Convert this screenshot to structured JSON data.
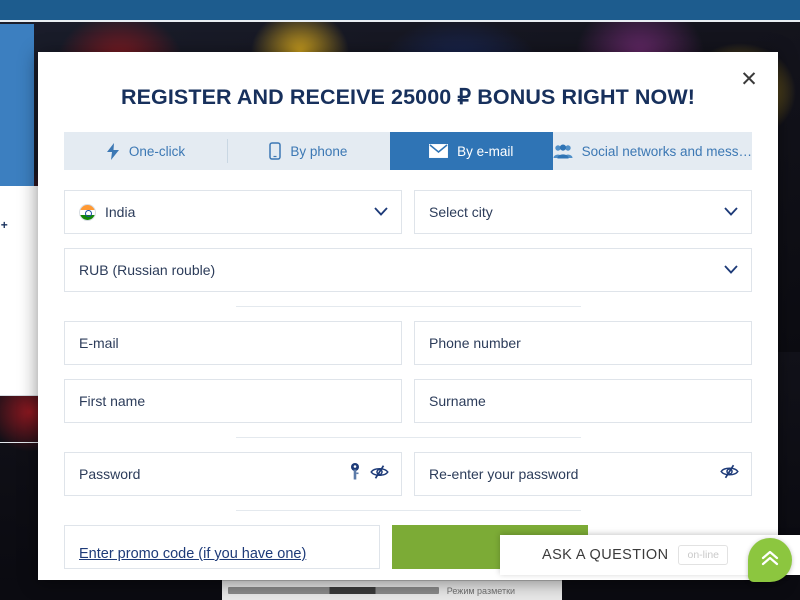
{
  "background": {
    "left_card_text": "| +",
    "status_bar_text": "Режим разметки",
    "top_bar_color": "#1d5c8e",
    "blue_panel_color": "#3c7fc0"
  },
  "modal": {
    "title": "REGISTER AND RECEIVE 25000 ₽ BONUS RIGHT NOW!",
    "close_label": "✕",
    "tabs": [
      {
        "label": "One-click",
        "icon": "bolt-icon",
        "active": false
      },
      {
        "label": "By phone",
        "icon": "phone-icon",
        "active": false
      },
      {
        "label": "By e-mail",
        "icon": "envelope-icon",
        "active": true
      },
      {
        "label": "Social networks and mess…",
        "icon": "people-icon",
        "active": false
      }
    ],
    "form": {
      "country": {
        "value": "India",
        "flag": "india-flag-icon"
      },
      "city": {
        "placeholder": "Select city"
      },
      "currency": {
        "value": "RUB (Russian rouble)"
      },
      "email": {
        "placeholder": "E-mail"
      },
      "phone": {
        "placeholder": "Phone number"
      },
      "first_name": {
        "placeholder": "First name"
      },
      "surname": {
        "placeholder": "Surname"
      },
      "password": {
        "placeholder": "Password"
      },
      "password_confirm": {
        "placeholder": "Re-enter your password"
      },
      "promo": {
        "label": "Enter promo code (if you have one)"
      },
      "register_button": {
        "label": "",
        "color": "#7cab36"
      }
    }
  },
  "chat": {
    "label": "ASK A QUESTION",
    "status_badge": "on-line",
    "accent_color": "#8cc63f"
  }
}
